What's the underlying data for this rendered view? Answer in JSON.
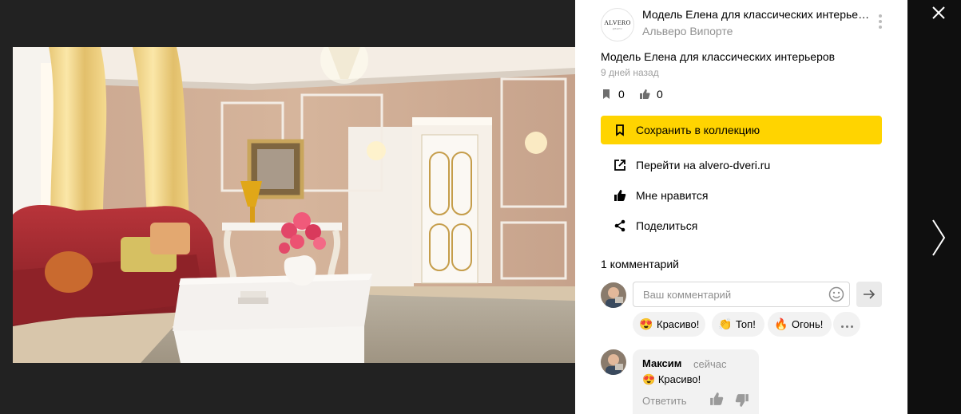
{
  "post": {
    "author_logo_text": "ALVERO",
    "author_logo_subtext": "ДВЕРИ",
    "title": "Модель Елена для классических интерьеров",
    "author": "Альверо Випорте",
    "description": "Модель Елена для классических интерьеров",
    "time": "9 дней назад",
    "saves_count": "0",
    "likes_count": "0"
  },
  "actions": {
    "save_label": "Сохранить в коллекцию",
    "visit_label": "Перейти на alvero-dveri.ru",
    "like_label": "Мне нравится",
    "share_label": "Поделиться"
  },
  "comments": {
    "count_label": "1 комментарий",
    "placeholder": "Ваш комментарий",
    "quick_reactions": [
      {
        "emoji": "😍",
        "label": "Красиво!"
      },
      {
        "emoji": "👏",
        "label": "Топ!"
      },
      {
        "emoji": "🔥",
        "label": "Огонь!"
      }
    ],
    "items": [
      {
        "author": "Максим",
        "time": "сейчас",
        "emoji": "😍",
        "text": "Красиво!",
        "reply_label": "Ответить"
      }
    ]
  },
  "colors": {
    "accent": "#ffd400",
    "panel_bg": "#ffffff",
    "viewer_bg": "#0f0f0f"
  },
  "icons": [
    "close-icon",
    "chevron-right-icon",
    "more-vertical-icon",
    "bookmark-icon",
    "thumb-up-icon",
    "external-link-icon",
    "share-icon",
    "smile-icon",
    "arrow-right-icon",
    "thumb-down-icon"
  ]
}
